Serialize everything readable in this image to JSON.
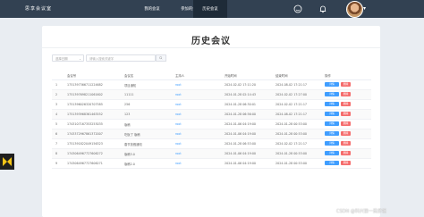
{
  "nav": {
    "brand": "思享会议室",
    "tabs": [
      "我的会议",
      "参加的会议",
      "历史会议"
    ],
    "active_tab": 2,
    "icons": [
      "smile-icon",
      "bell-icon"
    ]
  },
  "page": {
    "title": "历史会议",
    "filter_select": "选择日期",
    "search_placeholder": "请输入搜索关键字"
  },
  "table": {
    "headers": [
      "会议号",
      "会议名",
      "主持人",
      "开始时间",
      "结束时间",
      "操作"
    ],
    "detail_label": "详情",
    "delete_label": "删除",
    "rows": [
      {
        "index": "1",
        "code": "1751397366711224682",
        "name": "项目通知",
        "host": "root",
        "start": "2024-02-02 17:11:20",
        "end": "2024-08-02 17:21:17"
      },
      {
        "index": "2",
        "code": "1751397698211061602",
        "name": "11111",
        "host": "root",
        "start": "2024-01-28 02:14:43",
        "end": "2024-02-02 17:27:00"
      },
      {
        "index": "3",
        "code": "1751396026320707585",
        "name": "256",
        "host": "root",
        "start": "2024-01-28 06:30:01",
        "end": "2024-02-02 17:21:17"
      },
      {
        "index": "4",
        "code": "1751393968361463552",
        "name": "123",
        "host": "root",
        "start": "2024-01-28 06:56:00",
        "end": "2024-08-02 17:21:17"
      },
      {
        "index": "5",
        "code": "1743107167353253035",
        "name": "版稿",
        "host": "root",
        "start": "2024-01-06 04:19:00",
        "end": "2024-01-28 00:53:00"
      },
      {
        "index": "6",
        "code": "1743372967861372007",
        "name": "吃饭了 版稿",
        "host": "root",
        "start": "2024-01-06 04:19:00",
        "end": "2024-01-28 00:53:00"
      },
      {
        "index": "7",
        "code": "1751391822049156323",
        "name": "春节放假通知",
        "host": "root",
        "start": "2024-01-28 06:53:00",
        "end": "2024-02-02 17:21:17"
      },
      {
        "index": "8",
        "code": "1743064967727606272",
        "name": "版稿3.0",
        "host": "root",
        "start": "2024-01-06 04:19:00",
        "end": "2024-01-28 00:53:00"
      },
      {
        "index": "9",
        "code": "1743064967727606271",
        "name": "版稿2.0",
        "host": "root",
        "start": "2024-01-06 04:19:00",
        "end": "2024-01-28 00:53:00"
      }
    ]
  },
  "watermark": "CSDN @科兴第一吴彦祖",
  "colors": {
    "nav_bg": "#324152",
    "nav_active": "#1e2b38",
    "primary": "#409eff",
    "danger": "#f56c6c",
    "page_bg": "#e9edf2"
  }
}
